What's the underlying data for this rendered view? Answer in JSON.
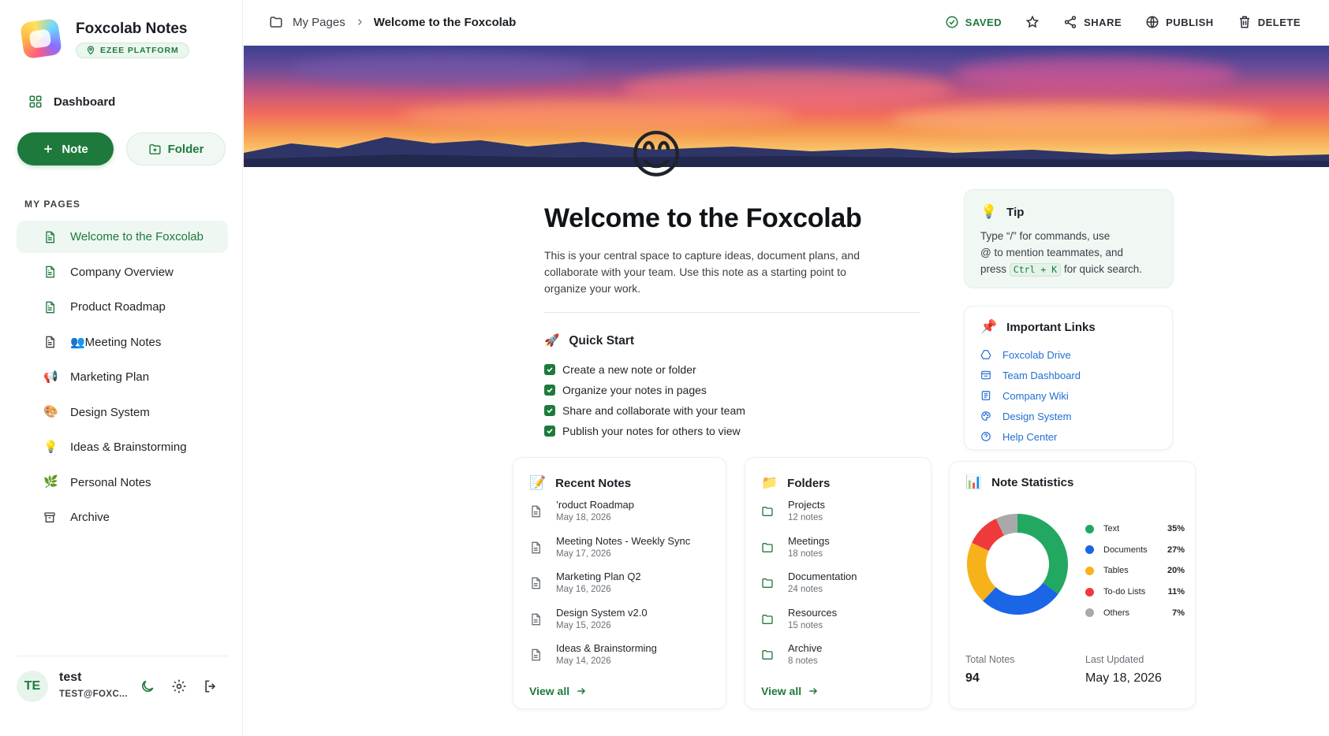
{
  "app": {
    "title": "Foxcolab Notes",
    "badge": "EZEE PLATFORM"
  },
  "sidebar": {
    "dashboard": "Dashboard",
    "new_note": "Note",
    "new_folder": "Folder",
    "section_label": "MY PAGES",
    "pages": [
      {
        "label": "Welcome to the Foxcolab",
        "icon": "document-icon",
        "active": true
      },
      {
        "label": "Company Overview",
        "icon": "document-icon"
      },
      {
        "label": "Product Roadmap",
        "icon": "document-icon"
      },
      {
        "label": "👥Meeting Notes",
        "icon": "document-icon"
      },
      {
        "label": "Marketing Plan",
        "icon": "megaphone-icon"
      },
      {
        "label": "Design System",
        "icon": "palette-icon"
      },
      {
        "label": "Ideas & Brainstorming",
        "icon": "lightbulb-icon"
      },
      {
        "label": "Personal Notes",
        "icon": "leaf-icon"
      },
      {
        "label": "Archive",
        "icon": "archive-icon"
      }
    ],
    "user": {
      "initials": "TE",
      "name": "test",
      "email": "TEST@FOXC..."
    }
  },
  "topbar": {
    "breadcrumb_root": "My Pages",
    "breadcrumb_current": "Welcome to the Foxcolab",
    "saved": "SAVED",
    "share": "SHARE",
    "publish": "PUBLISH",
    "delete": "DELETE"
  },
  "document": {
    "title": "Welcome to the Foxcolab",
    "intro": "This is your central space to capture ideas, document plans, and collaborate with your team. Use this note as a starting point to organize your work.",
    "quick_start": {
      "title": "Quick Start",
      "items": [
        "Create a new note or folder",
        "Organize your notes in pages",
        "Share and collaborate with your team",
        "Publish your notes for others to view"
      ]
    }
  },
  "tip": {
    "title": "Tip",
    "line1": "Type “/” for commands, use",
    "line2": "@ to mention teammates, and",
    "line3_pre": "press",
    "shortcut": "Ctrl + K",
    "line3_post": "for quick search."
  },
  "important_links": {
    "title": "Important Links",
    "items": [
      {
        "label": "Foxcolab Drive",
        "icon": "drive-icon"
      },
      {
        "label": "Team Dashboard",
        "icon": "dashboard-icon"
      },
      {
        "label": "Company Wiki",
        "icon": "wiki-icon"
      },
      {
        "label": "Design System",
        "icon": "palette-icon"
      },
      {
        "label": "Help Center",
        "icon": "help-icon"
      }
    ]
  },
  "recent_notes": {
    "title": "Recent Notes",
    "items": [
      {
        "title": "’roduct Roadmap",
        "date": "May 18, 2026"
      },
      {
        "title": "Meeting Notes - Weekly Sync",
        "date": "May 17, 2026"
      },
      {
        "title": "Marketing Plan Q2",
        "date": "May 16, 2026"
      },
      {
        "title": "Design System v2.0",
        "date": "May 15, 2026"
      },
      {
        "title": "Ideas & Brainstorming",
        "date": "May 14, 2026"
      }
    ],
    "view_all": "View all"
  },
  "folders": {
    "title": "Folders",
    "items": [
      {
        "name": "Projects",
        "count": "12 notes"
      },
      {
        "name": "Meetings",
        "count": "18 notes"
      },
      {
        "name": "Documentation",
        "count": "24 notes"
      },
      {
        "name": "Resources",
        "count": "15 notes"
      },
      {
        "name": "Archive",
        "count": "8 notes"
      }
    ],
    "view_all": "View all"
  },
  "note_statistics": {
    "title": "Note Statistics",
    "segments": [
      {
        "label": "Text",
        "value": "35%",
        "pct": 35,
        "color": "#22a861"
      },
      {
        "label": "Documents",
        "value": "27%",
        "pct": 27,
        "color": "#1a66e6"
      },
      {
        "label": "Tables",
        "value": "20%",
        "pct": 20,
        "color": "#f7b21b"
      },
      {
        "label": "To-do Lists",
        "value": "11%",
        "pct": 11,
        "color": "#ee3a3a"
      },
      {
        "label": "Others",
        "value": "7%",
        "pct": 7,
        "color": "#a9a9a9"
      }
    ],
    "total_label": "Total Notes",
    "total_value": "94",
    "updated_label": "Last Updated",
    "updated_value": "May 18, 2026"
  },
  "colors": {
    "brand": "#1e7a3c",
    "link": "#1f6fd1"
  }
}
